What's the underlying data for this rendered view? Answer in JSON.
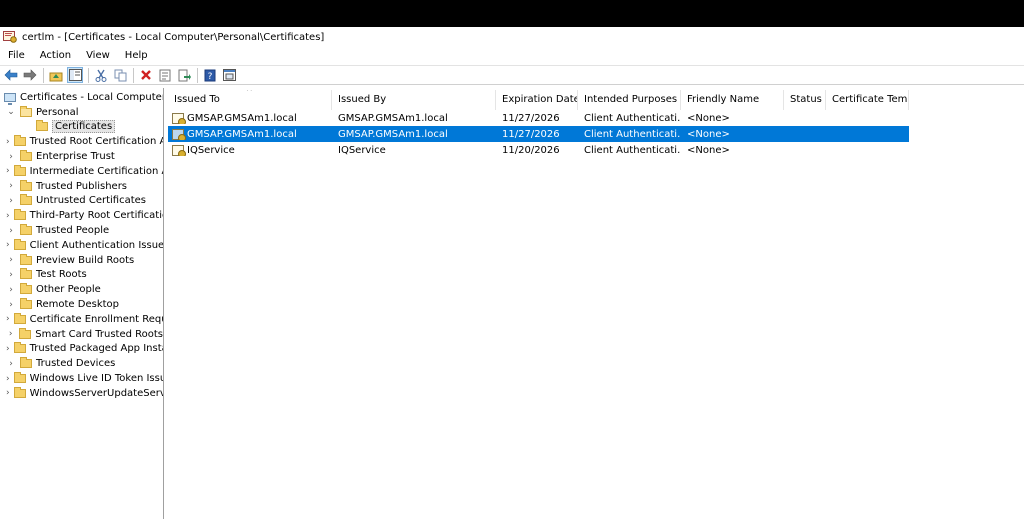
{
  "window": {
    "title": "certlm - [Certificates - Local Computer\\Personal\\Certificates]"
  },
  "menu": [
    "File",
    "Action",
    "View",
    "Help"
  ],
  "toolbar": [
    "back-arrow-icon",
    "forward-arrow-icon",
    "up-folder-icon",
    "show-hide-tree-icon",
    "cut-icon",
    "copy-icon",
    "delete-icon",
    "properties-icon",
    "export-list-icon",
    "help-icon",
    "console-view-icon"
  ],
  "tree": {
    "root": "Certificates - Local Computer",
    "personal": "Personal",
    "certificates": "Certificates",
    "stores": [
      "Trusted Root Certification Au",
      "Enterprise Trust",
      "Intermediate Certification Au",
      "Trusted Publishers",
      "Untrusted Certificates",
      "Third-Party Root Certification",
      "Trusted People",
      "Client Authentication Issuers",
      "Preview Build Roots",
      "Test Roots",
      "Other People",
      "Remote Desktop",
      "Certificate Enrollment Reques",
      "Smart Card Trusted Roots",
      "Trusted Packaged App Installa",
      "Trusted Devices",
      "Windows Live ID Token Issuer",
      "WindowsServerUpdateService"
    ]
  },
  "list": {
    "columns": [
      "Issued To",
      "Issued By",
      "Expiration Date",
      "Intended Purposes",
      "Friendly Name",
      "Status",
      "Certificate Tem..."
    ],
    "rows": [
      {
        "issued_to": "GMSAP.GMSAm1.local",
        "issued_by": "GMSAP.GMSAm1.local",
        "expiration": "11/27/2026",
        "purposes": "Client Authenticati...",
        "friendly": "<None>",
        "status": "",
        "template": "",
        "selected": false
      },
      {
        "issued_to": "GMSAP.GMSAm1.local",
        "issued_by": "GMSAP.GMSAm1.local",
        "expiration": "11/27/2026",
        "purposes": "Client Authenticati...",
        "friendly": "<None>",
        "status": "",
        "template": "",
        "selected": true
      },
      {
        "issued_to": "IQService",
        "issued_by": "IQService",
        "expiration": "11/20/2026",
        "purposes": "Client Authenticati...",
        "friendly": "<None>",
        "status": "",
        "template": "",
        "selected": false
      }
    ]
  },
  "colors": {
    "selection": "#0078d7",
    "folder": "#f5d168"
  }
}
